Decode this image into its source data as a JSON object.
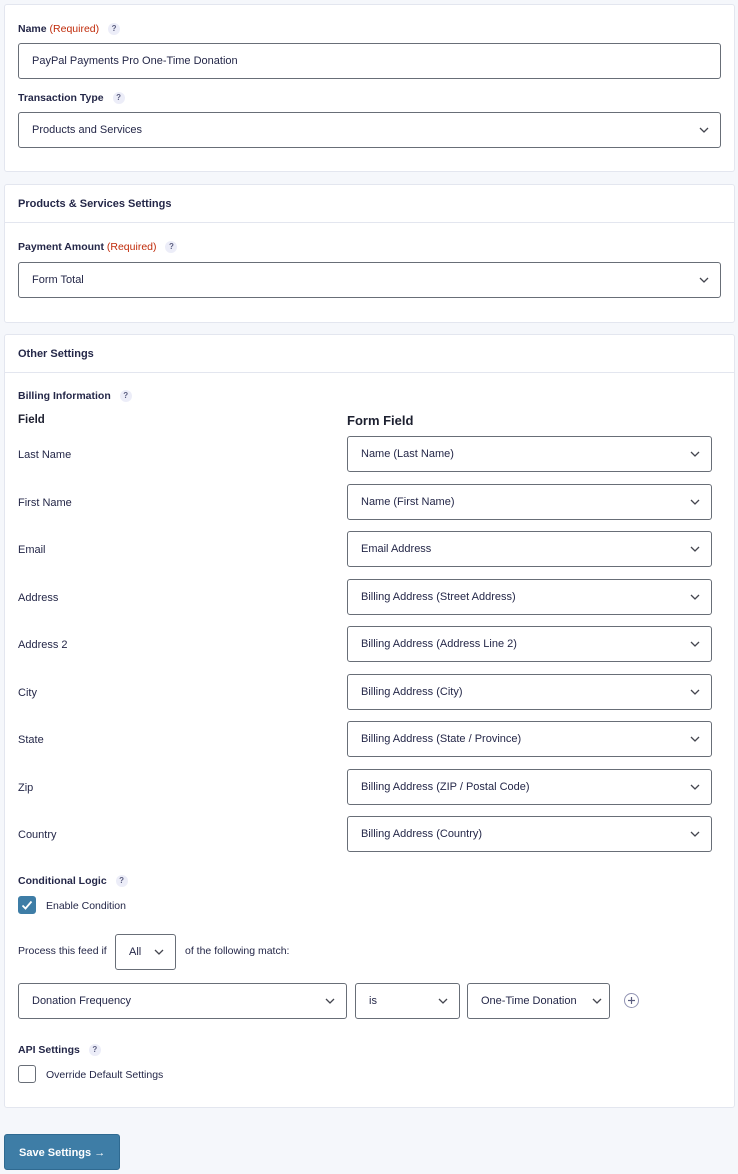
{
  "general": {
    "name_label": "Name",
    "name_required": "(Required)",
    "name_value": "PayPal Payments Pro One-Time Donation",
    "transaction_type_label": "Transaction Type",
    "transaction_type_value": "Products and Services",
    "help_glyph": "?"
  },
  "products_services": {
    "title": "Products & Services Settings",
    "payment_amount_label": "Payment Amount",
    "payment_amount_required": "(Required)",
    "payment_amount_value": "Form Total"
  },
  "other_settings": {
    "title": "Other Settings",
    "billing_information_label": "Billing Information",
    "field_header": "Field",
    "form_field_header": "Form Field",
    "billing_rows": [
      {
        "field": "Last Name",
        "form_field": "Name (Last Name)"
      },
      {
        "field": "First Name",
        "form_field": "Name (First Name)"
      },
      {
        "field": "Email",
        "form_field": "Email Address"
      },
      {
        "field": "Address",
        "form_field": "Billing Address (Street Address)"
      },
      {
        "field": "Address 2",
        "form_field": "Billing Address (Address Line 2)"
      },
      {
        "field": "City",
        "form_field": "Billing Address (City)"
      },
      {
        "field": "State",
        "form_field": "Billing Address (State / Province)"
      },
      {
        "field": "Zip",
        "form_field": "Billing Address (ZIP / Postal Code)"
      },
      {
        "field": "Country",
        "form_field": "Billing Address (Country)"
      }
    ],
    "conditional_logic_label": "Conditional Logic",
    "enable_condition_label": "Enable Condition",
    "enable_condition_checked": true,
    "process_prefix": "Process this feed if",
    "match_type": "All",
    "process_suffix": "of the following match:",
    "rule": {
      "field": "Donation Frequency",
      "operator": "is",
      "value": "One-Time Donation"
    },
    "api_settings_label": "API Settings",
    "override_label": "Override Default Settings",
    "override_checked": false
  },
  "footer": {
    "save_label": "Save Settings →"
  },
  "icons": {
    "chevron": "chevron-down-icon",
    "help": "help-icon",
    "check": "checkmark-icon",
    "add": "plus-circle-icon"
  },
  "colors": {
    "accent": "#3e7da6",
    "required": "#c02b0a",
    "border": "#686e77",
    "background": "#f5f7fb"
  }
}
